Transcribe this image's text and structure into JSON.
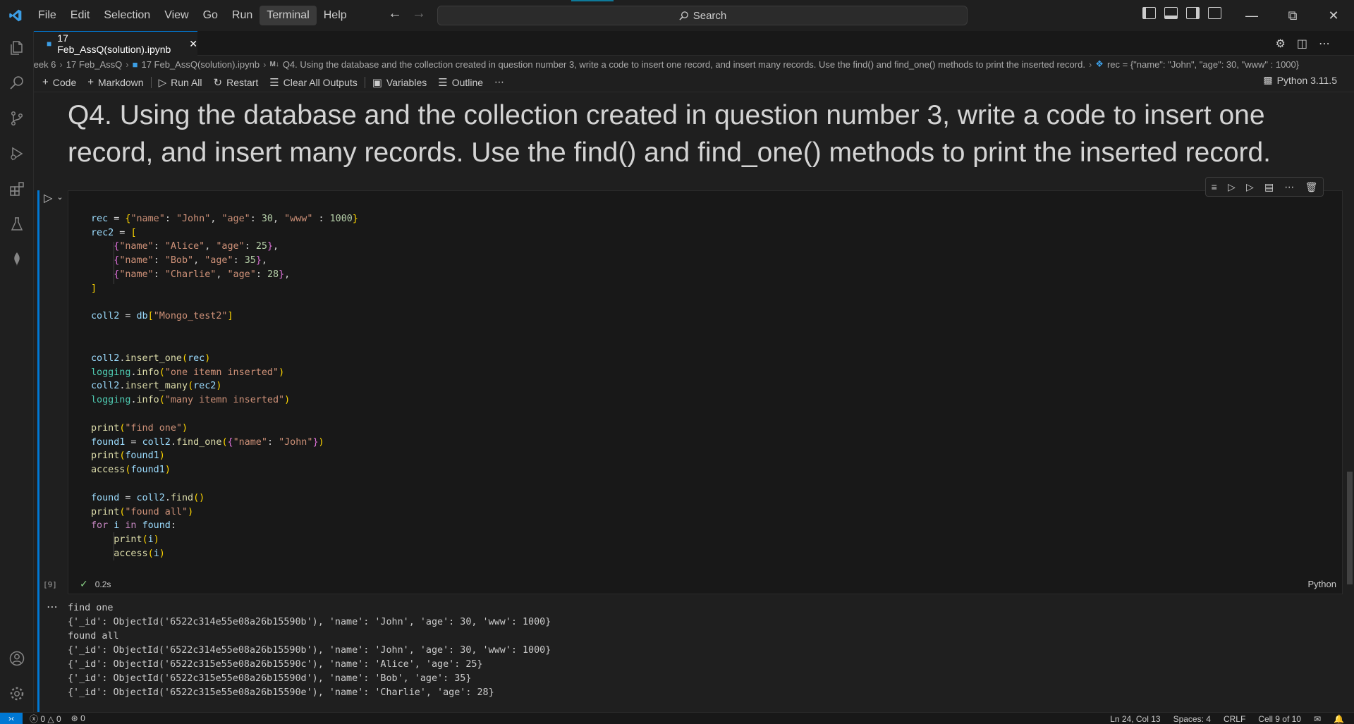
{
  "titlebar": {
    "menu": [
      "File",
      "Edit",
      "Selection",
      "View",
      "Go",
      "Run",
      "Terminal",
      "Help"
    ],
    "active_menu_index": 6,
    "search_placeholder": "Search"
  },
  "tab": {
    "label": "17 Feb_AssQ(solution).ipynb"
  },
  "breadcrumb": {
    "items": [
      "/eek 6",
      "17 Feb_AssQ",
      "17 Feb_AssQ(solution).ipynb",
      "Q4. Using the database and the collection created in question number 3, write a code to insert one record, and insert many records. Use the find() and find_one() methods to print the inserted record.",
      "rec = {\"name\": \"John\", \"age\": 30, \"www\" : 1000}"
    ]
  },
  "toolbar": {
    "code_label": "Code",
    "markdown_label": "Markdown",
    "run_all_label": "Run All",
    "restart_label": "Restart",
    "clear_label": "Clear All Outputs",
    "variables_label": "Variables",
    "outline_label": "Outline",
    "kernel_label": "Python 3.11.5"
  },
  "markdown_cell": {
    "heading": "Q4. Using the database and the collection created in question number 3, write a code to insert one record, and insert many records. Use the find() and find_one() methods to print the inserted record."
  },
  "code_cell": {
    "execution_count": "[9]",
    "duration": "0.2s",
    "language": "Python"
  },
  "output_lines": [
    "find one",
    "{'_id': ObjectId('6522c314e55e08a26b15590b'), 'name': 'John', 'age': 30, 'www': 1000}",
    "found all",
    "{'_id': ObjectId('6522c314e55e08a26b15590b'), 'name': 'John', 'age': 30, 'www': 1000}",
    "{'_id': ObjectId('6522c315e55e08a26b15590c'), 'name': 'Alice', 'age': 25}",
    "{'_id': ObjectId('6522c315e55e08a26b15590d'), 'name': 'Bob', 'age': 35}",
    "{'_id': ObjectId('6522c315e55e08a26b15590e'), 'name': 'Charlie', 'age': 28}"
  ],
  "statusbar": {
    "errors": "0",
    "warnings": "0",
    "ports": "0",
    "position": "Ln 24, Col 13",
    "spaces": "Spaces: 4",
    "eol": "CRLF",
    "cell": "Cell 9 of 10"
  },
  "colors": {
    "accent": "#0078d4",
    "background": "#1f1f1f",
    "cell_background": "#181818"
  }
}
